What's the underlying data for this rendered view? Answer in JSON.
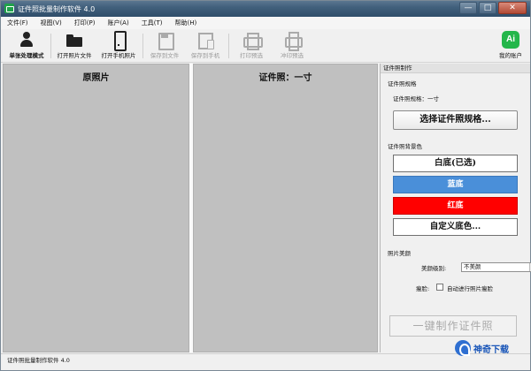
{
  "window": {
    "title": "证件照批量制作软件 4.0",
    "controls": {
      "minimize": "—",
      "maximize": "□",
      "close": "✕"
    }
  },
  "menu": [
    "文件(F)",
    "视图(V)",
    "打印(P)",
    "账户(A)",
    "工具(T)",
    "帮助(H)"
  ],
  "toolbar": {
    "single_mode": "单张处理模式",
    "open_file": "打开照片文件",
    "open_phone": "打开手机照片",
    "save_file": "保存到文件",
    "save_phone": "保存到手机",
    "print_preview": "打印预选",
    "cut_preview": "冲印预选",
    "my_account": "我的账户",
    "ai_badge": "Ai"
  },
  "panels": {
    "original_title": "原照片",
    "result_title": "证件照：一寸"
  },
  "right_panel": {
    "header": "证件照制作",
    "spec_section": "证件照规格",
    "spec_current": "证件照规格：一寸",
    "choose_spec_button": "选择证件照规格...",
    "bg_section": "证件照背景色",
    "bg_white": "白底(已选)",
    "bg_blue": "蓝底",
    "bg_red": "红底",
    "bg_custom": "自定义底色...",
    "beauty_section": "照片美颜",
    "beauty_level_label": "美颜级别:",
    "beauty_level_value": "不美颜",
    "face_label": "瘦脸:",
    "face_checkbox_label": "自动进行照片瘦脸",
    "face_checked": false,
    "make_button": "一键制作证件照"
  },
  "status": {
    "text": "证件照批量制作软件 4.0"
  },
  "watermark": "神奇下载",
  "colors": {
    "blue_bg": "#4a8fd9",
    "red_bg": "#ff0000",
    "ai_green": "#23b64a"
  }
}
